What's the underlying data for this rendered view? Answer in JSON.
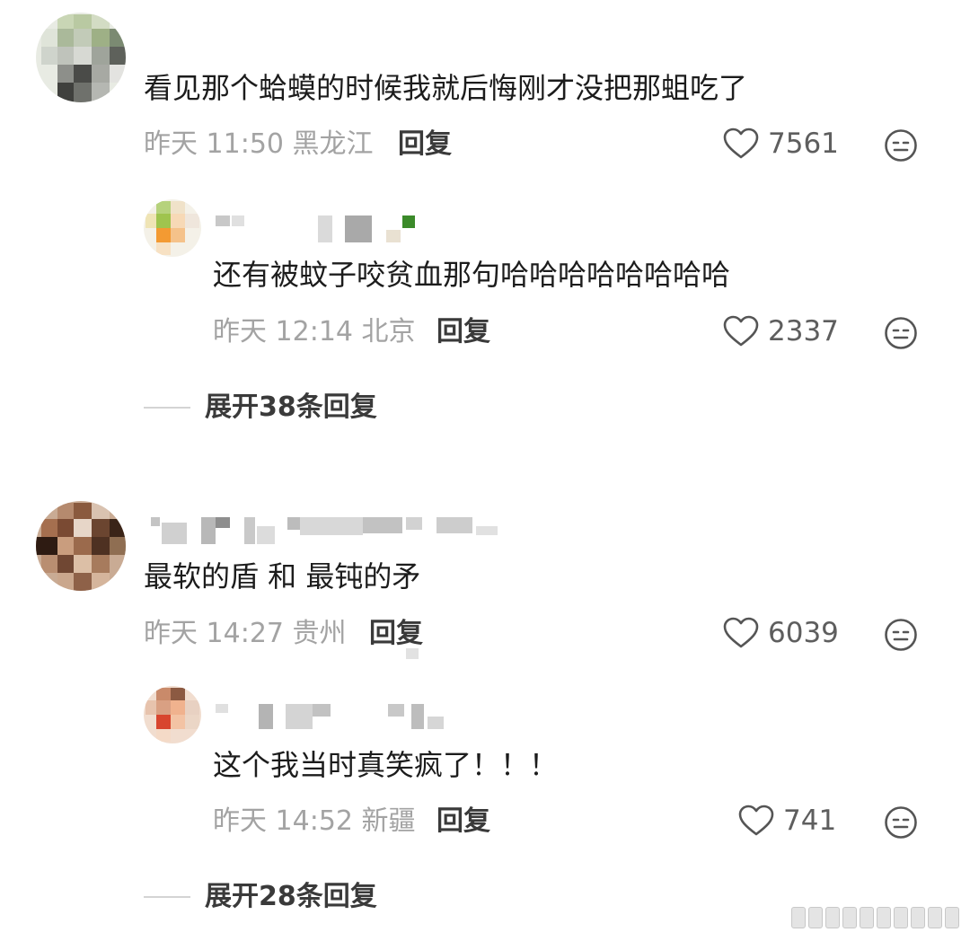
{
  "comments": [
    {
      "text": "看见那个蛤蟆的时候我就后悔刚才没把那蛆吃了",
      "meta": "昨天 11:50 黑龙江",
      "reply_label": "回复",
      "likes": "7561",
      "replies": [
        {
          "text": "还有被蚊子咬贫血那句哈哈哈哈哈哈哈哈",
          "meta": "昨天 12:14 北京",
          "reply_label": "回复",
          "likes": "2337"
        }
      ],
      "expand_label": "展开38条回复"
    },
    {
      "text": "最软的盾 和 最钝的矛",
      "meta": "昨天 14:27 贵州",
      "reply_label": "回复",
      "likes": "6039",
      "replies": [
        {
          "text": "这个我当时真笑疯了！！！",
          "meta": "昨天 14:52 新疆",
          "reply_label": "回复",
          "likes": "741"
        }
      ],
      "expand_label": "展开28条回复"
    }
  ],
  "icons": {
    "like": "heart-outline-icon",
    "dislike": "neutral-face-icon"
  },
  "colors": {
    "primary_text": "#1c1c1c",
    "meta_text": "#a3a3a3",
    "action_text": "#3a3a3a",
    "icon_stroke": "#555555"
  }
}
